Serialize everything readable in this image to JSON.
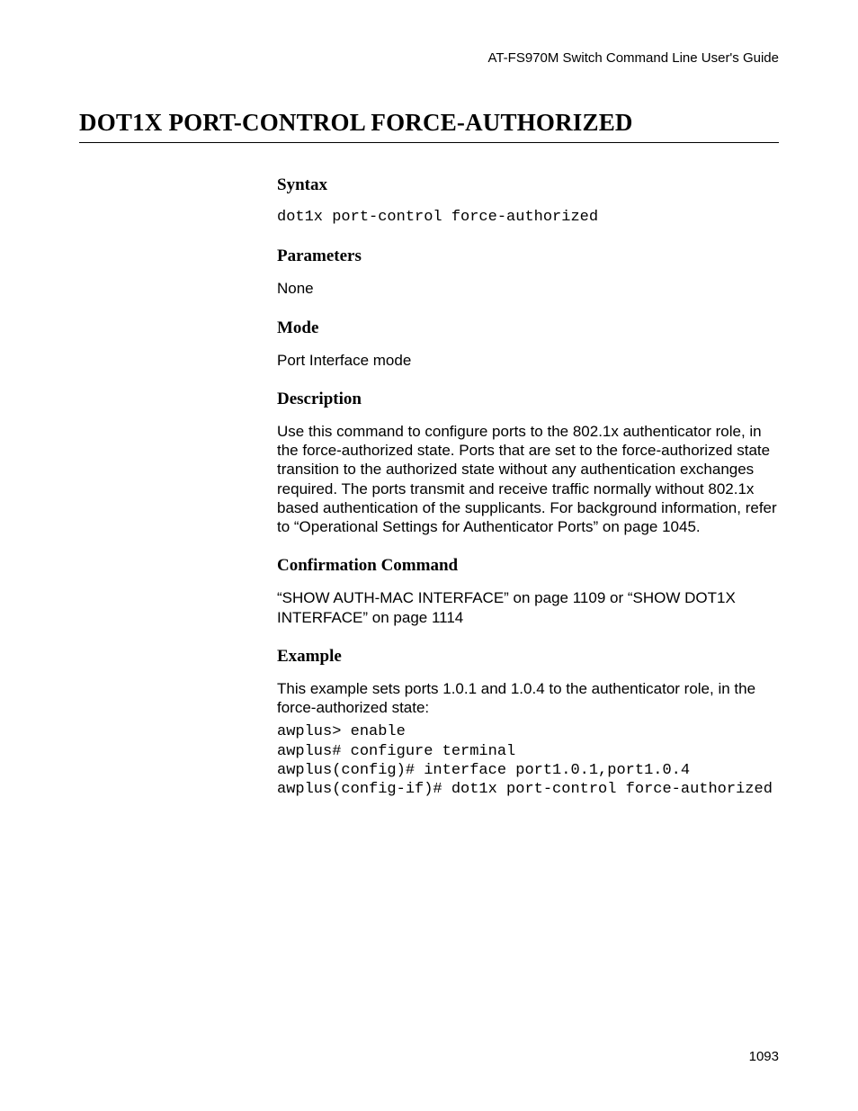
{
  "header": {
    "running_title": "AT-FS970M Switch Command Line User's Guide"
  },
  "title": "DOT1X PORT-CONTROL FORCE-AUTHORIZED",
  "sections": {
    "syntax": {
      "heading": "Syntax",
      "code": "dot1x port-control force-authorized"
    },
    "parameters": {
      "heading": "Parameters",
      "text": "None"
    },
    "mode": {
      "heading": "Mode",
      "text": "Port Interface mode"
    },
    "description": {
      "heading": "Description",
      "text": "Use this command to configure ports to the 802.1x authenticator role, in the force-authorized state. Ports that are set to the force-authorized state transition to the authorized state without any authentication exchanges required. The ports transmit and receive traffic normally without 802.1x based authentication of the supplicants. For background information, refer to “Operational Settings for Authenticator Ports” on page 1045."
    },
    "confirmation": {
      "heading": "Confirmation Command",
      "text": "“SHOW AUTH-MAC INTERFACE” on page 1109 or “SHOW DOT1X INTERFACE” on page 1114"
    },
    "example": {
      "heading": "Example",
      "intro": "This example sets ports 1.0.1 and 1.0.4 to the authenticator role, in the force-authorized state:",
      "code": "awplus> enable\nawplus# configure terminal\nawplus(config)# interface port1.0.1,port1.0.4\nawplus(config-if)# dot1x port-control force-authorized"
    }
  },
  "footer": {
    "page_number": "1093"
  }
}
